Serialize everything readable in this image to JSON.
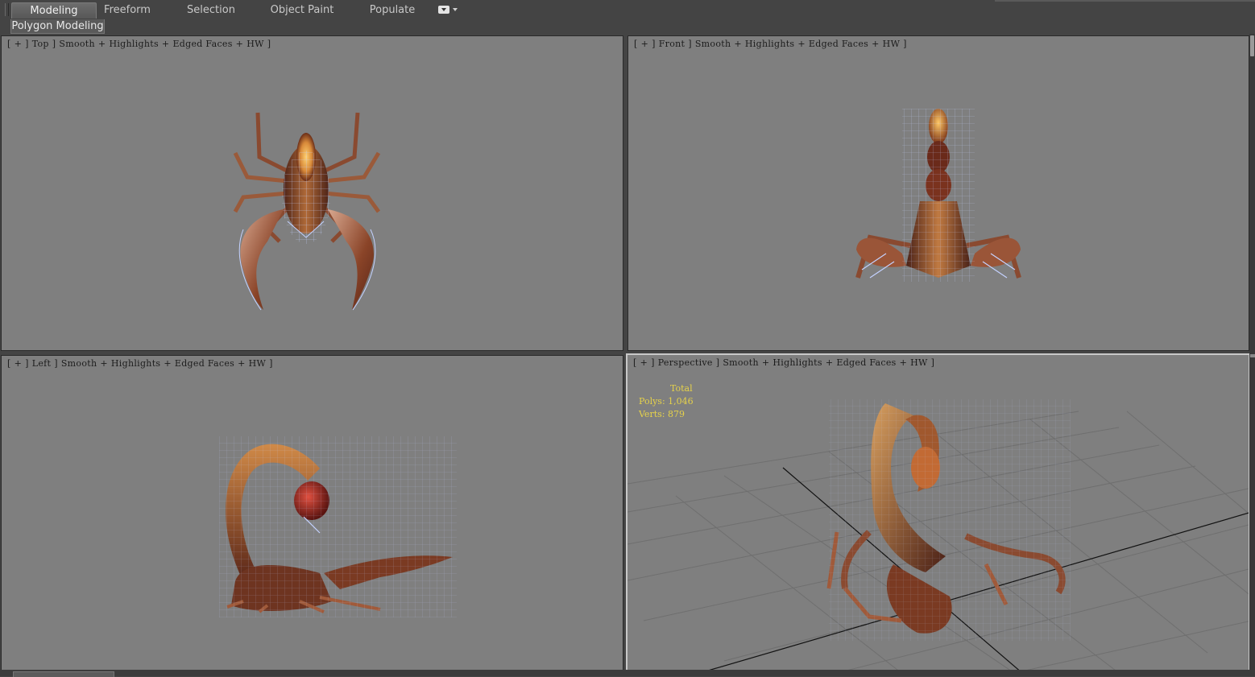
{
  "ribbon": {
    "tabs": [
      {
        "label": "Modeling",
        "active": true
      },
      {
        "label": "Freeform",
        "active": false
      },
      {
        "label": "Selection",
        "active": false
      },
      {
        "label": "Object Paint",
        "active": false
      },
      {
        "label": "Populate",
        "active": false
      }
    ],
    "customize_icon": "ribbon-options-icon",
    "panel_label": "Polygon Modeling"
  },
  "viewports": [
    {
      "name": "Top",
      "active": false,
      "label": [
        "[",
        "+",
        "]",
        "Top",
        "]",
        "Smooth",
        "+",
        "Highlights",
        "+",
        "Edged Faces",
        "+",
        "HW",
        "]"
      ]
    },
    {
      "name": "Front",
      "active": false,
      "label": [
        "[",
        "+",
        "]",
        "Front",
        "]",
        "Smooth",
        "+",
        "Highlights",
        "+",
        "Edged Faces",
        "+",
        "HW",
        "]"
      ]
    },
    {
      "name": "Left",
      "active": false,
      "label": [
        "[",
        "+",
        "]",
        "Left",
        "]",
        "Smooth",
        "+",
        "Highlights",
        "+",
        "Edged Faces",
        "+",
        "HW",
        "]"
      ]
    },
    {
      "name": "Perspective",
      "active": true,
      "label": [
        "[",
        "+",
        "]",
        "Perspective",
        "]",
        "Smooth",
        "+",
        "Highlights",
        "+",
        "Edged Faces",
        "+",
        "HW",
        "]"
      ]
    }
  ],
  "stats": {
    "header": "Total",
    "polys_label": "Polys:",
    "polys_value": "1,046",
    "verts_label": "Verts:",
    "verts_value": "879"
  },
  "colors": {
    "viewport_bg": "#7f7f7f",
    "ui_bg": "#444444",
    "wire": "#c4d2ff",
    "body_dark": "#5e2c1c",
    "body_light": "#d89048",
    "stats_text": "#e6d24a",
    "grid": "#6f6f6f",
    "axis": "#111111"
  }
}
